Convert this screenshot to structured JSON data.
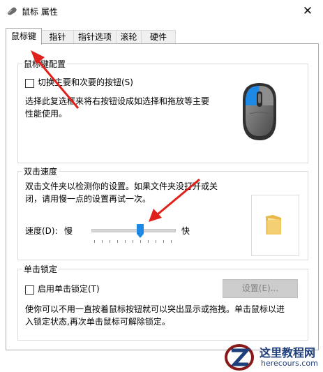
{
  "window": {
    "title": "鼠标 属性",
    "close_glyph": "✕"
  },
  "tabs": [
    {
      "label": "鼠标键",
      "active": true
    },
    {
      "label": "指针",
      "active": false
    },
    {
      "label": "指针选项",
      "active": false
    },
    {
      "label": "滚轮",
      "active": false
    },
    {
      "label": "硬件",
      "active": false
    }
  ],
  "button_config": {
    "title": "鼠标键配置",
    "checkbox_label": "切换主要和次要的按钮(S)",
    "checked": false,
    "desc_line1": "选择此复选框来将右按钮设成如选择和拖放等主要",
    "desc_line2": "性能使用。"
  },
  "double_click": {
    "title": "双击速度",
    "desc_line1": "双击文件夹以检测你的设置。如果文件夹没打开或关",
    "desc_line2": "闭，请用慢一点的设置再试一次。",
    "speed_label": "速度(D):",
    "slow_label": "慢",
    "fast_label": "快",
    "speed_level": 0.6
  },
  "click_lock": {
    "title": "单击锁定",
    "checkbox_label": "启用单击锁定(T)",
    "checked": false,
    "settings_button": "设置(E)...",
    "desc_line1": "使你可以不用一直按着鼠标按钮就可以突出显示或拖拽。单击鼠标以进",
    "desc_line2": "入锁定状态,再次单击鼠标可解除锁定。"
  },
  "watermark": {
    "brand": "这里教程网",
    "url": "herecours.com"
  },
  "colors": {
    "accent_blue": "#1e88e5",
    "arrow_red": "#e0201b",
    "watermark_navy": "#1f3e7c"
  }
}
